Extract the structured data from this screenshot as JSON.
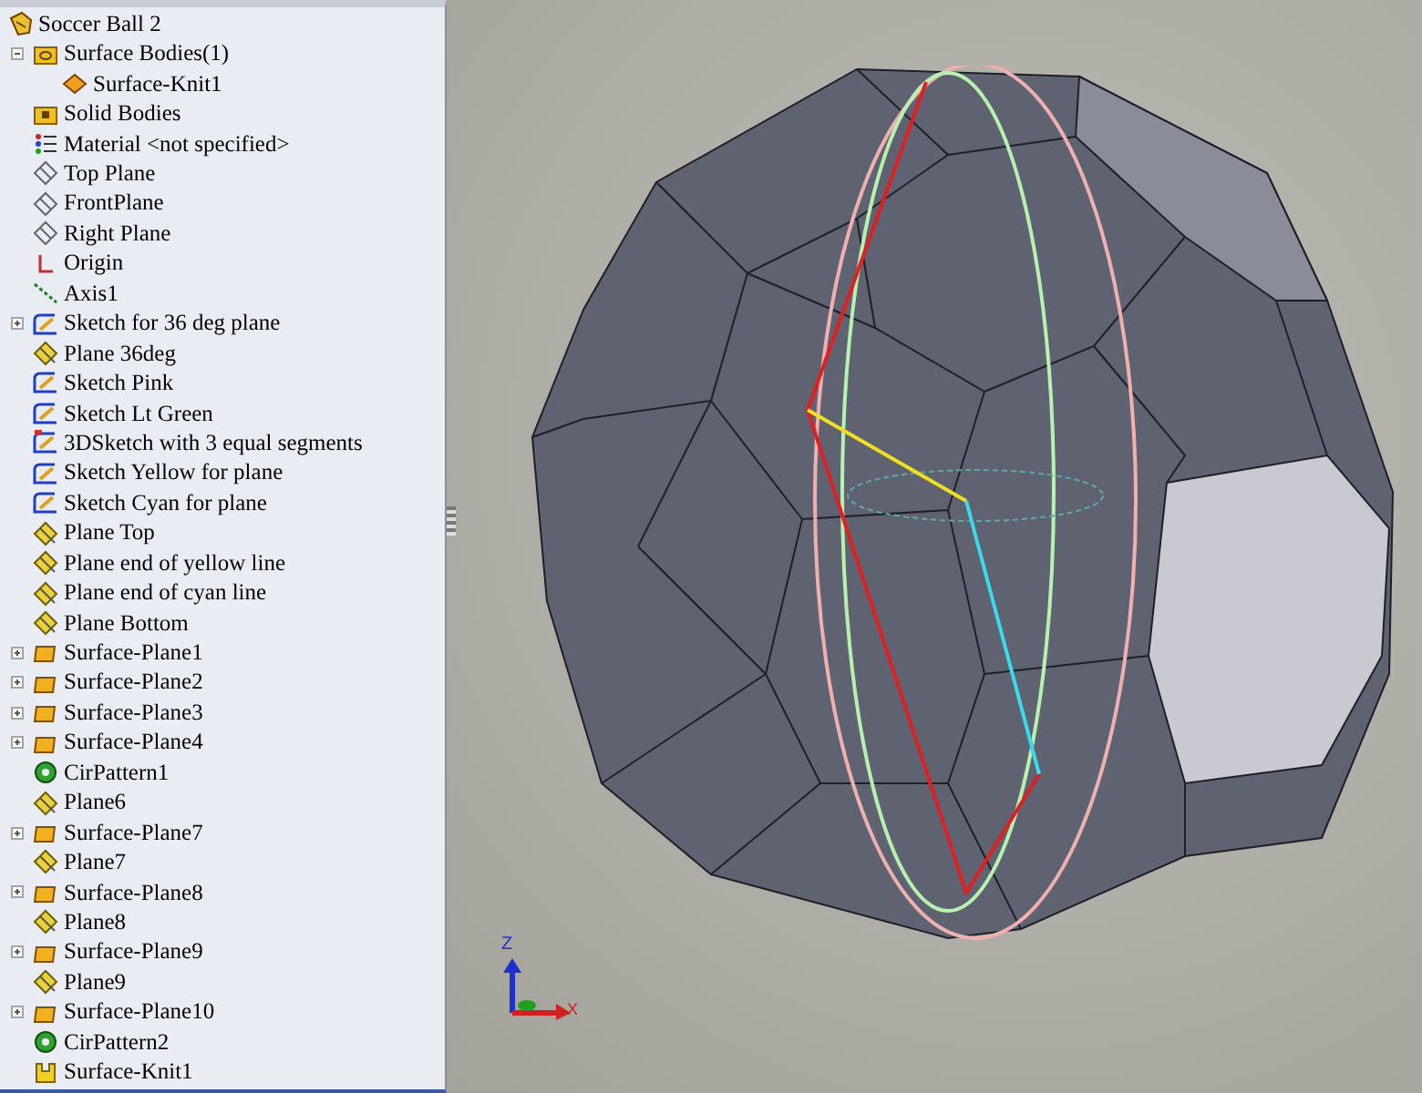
{
  "tree": {
    "label": "Soccer Ball 2",
    "kind": "part",
    "children": [
      {
        "label": "Surface Bodies(1)",
        "kind": "surface-bodies",
        "expanded": true,
        "children": [
          {
            "label": "Surface-Knit1",
            "kind": "body"
          }
        ]
      },
      {
        "label": "Solid Bodies",
        "kind": "solid-bodies"
      },
      {
        "label": "Material <not specified>",
        "kind": "material"
      },
      {
        "label": "Top Plane",
        "kind": "ref-plane"
      },
      {
        "label": "FrontPlane",
        "kind": "ref-plane"
      },
      {
        "label": "Right Plane",
        "kind": "ref-plane"
      },
      {
        "label": "Origin",
        "kind": "origin"
      },
      {
        "label": "Axis1",
        "kind": "axis"
      },
      {
        "label": "Sketch for 36 deg plane",
        "kind": "sketch",
        "expanded": false
      },
      {
        "label": "Plane 36deg",
        "kind": "plane"
      },
      {
        "label": "Sketch Pink",
        "kind": "sketch"
      },
      {
        "label": "Sketch Lt Green",
        "kind": "sketch"
      },
      {
        "label": "3DSketch with 3 equal segments",
        "kind": "sketch3d"
      },
      {
        "label": "Sketch Yellow for plane",
        "kind": "sketch"
      },
      {
        "label": "Sketch Cyan for plane",
        "kind": "sketch"
      },
      {
        "label": "Plane Top",
        "kind": "plane"
      },
      {
        "label": "Plane end of yellow line",
        "kind": "plane"
      },
      {
        "label": "Plane end of cyan line",
        "kind": "plane"
      },
      {
        "label": "Plane Bottom",
        "kind": "plane"
      },
      {
        "label": "Surface-Plane1",
        "kind": "surface",
        "expanded": false
      },
      {
        "label": "Surface-Plane2",
        "kind": "surface",
        "expanded": false
      },
      {
        "label": "Surface-Plane3",
        "kind": "surface",
        "expanded": false
      },
      {
        "label": "Surface-Plane4",
        "kind": "surface",
        "expanded": false
      },
      {
        "label": "CirPattern1",
        "kind": "pattern"
      },
      {
        "label": "Plane6",
        "kind": "plane"
      },
      {
        "label": "Surface-Plane7",
        "kind": "surface",
        "expanded": false
      },
      {
        "label": "Plane7",
        "kind": "plane"
      },
      {
        "label": "Surface-Plane8",
        "kind": "surface",
        "expanded": false
      },
      {
        "label": "Plane8",
        "kind": "plane"
      },
      {
        "label": "Surface-Plane9",
        "kind": "surface",
        "expanded": false
      },
      {
        "label": "Plane9",
        "kind": "plane"
      },
      {
        "label": "Surface-Plane10",
        "kind": "surface",
        "expanded": false
      },
      {
        "label": "CirPattern2",
        "kind": "pattern"
      },
      {
        "label": "Surface-Knit1",
        "kind": "knit"
      }
    ]
  },
  "triad": {
    "z_label": "Z",
    "x_label": "X"
  }
}
